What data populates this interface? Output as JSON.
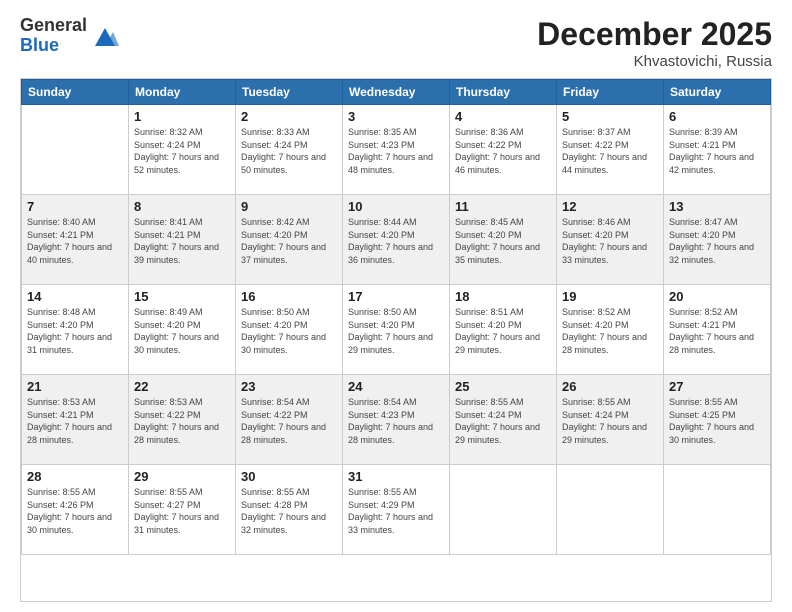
{
  "logo": {
    "general": "General",
    "blue": "Blue"
  },
  "header": {
    "month": "December 2025",
    "location": "Khvastovichi, Russia"
  },
  "weekdays": [
    "Sunday",
    "Monday",
    "Tuesday",
    "Wednesday",
    "Thursday",
    "Friday",
    "Saturday"
  ],
  "weeks": [
    [
      {
        "day": "",
        "sunrise": "",
        "sunset": "",
        "daylight": ""
      },
      {
        "day": "1",
        "sunrise": "Sunrise: 8:32 AM",
        "sunset": "Sunset: 4:24 PM",
        "daylight": "Daylight: 7 hours and 52 minutes."
      },
      {
        "day": "2",
        "sunrise": "Sunrise: 8:33 AM",
        "sunset": "Sunset: 4:24 PM",
        "daylight": "Daylight: 7 hours and 50 minutes."
      },
      {
        "day": "3",
        "sunrise": "Sunrise: 8:35 AM",
        "sunset": "Sunset: 4:23 PM",
        "daylight": "Daylight: 7 hours and 48 minutes."
      },
      {
        "day": "4",
        "sunrise": "Sunrise: 8:36 AM",
        "sunset": "Sunset: 4:22 PM",
        "daylight": "Daylight: 7 hours and 46 minutes."
      },
      {
        "day": "5",
        "sunrise": "Sunrise: 8:37 AM",
        "sunset": "Sunset: 4:22 PM",
        "daylight": "Daylight: 7 hours and 44 minutes."
      },
      {
        "day": "6",
        "sunrise": "Sunrise: 8:39 AM",
        "sunset": "Sunset: 4:21 PM",
        "daylight": "Daylight: 7 hours and 42 minutes."
      }
    ],
    [
      {
        "day": "7",
        "sunrise": "Sunrise: 8:40 AM",
        "sunset": "Sunset: 4:21 PM",
        "daylight": "Daylight: 7 hours and 40 minutes."
      },
      {
        "day": "8",
        "sunrise": "Sunrise: 8:41 AM",
        "sunset": "Sunset: 4:21 PM",
        "daylight": "Daylight: 7 hours and 39 minutes."
      },
      {
        "day": "9",
        "sunrise": "Sunrise: 8:42 AM",
        "sunset": "Sunset: 4:20 PM",
        "daylight": "Daylight: 7 hours and 37 minutes."
      },
      {
        "day": "10",
        "sunrise": "Sunrise: 8:44 AM",
        "sunset": "Sunset: 4:20 PM",
        "daylight": "Daylight: 7 hours and 36 minutes."
      },
      {
        "day": "11",
        "sunrise": "Sunrise: 8:45 AM",
        "sunset": "Sunset: 4:20 PM",
        "daylight": "Daylight: 7 hours and 35 minutes."
      },
      {
        "day": "12",
        "sunrise": "Sunrise: 8:46 AM",
        "sunset": "Sunset: 4:20 PM",
        "daylight": "Daylight: 7 hours and 33 minutes."
      },
      {
        "day": "13",
        "sunrise": "Sunrise: 8:47 AM",
        "sunset": "Sunset: 4:20 PM",
        "daylight": "Daylight: 7 hours and 32 minutes."
      }
    ],
    [
      {
        "day": "14",
        "sunrise": "Sunrise: 8:48 AM",
        "sunset": "Sunset: 4:20 PM",
        "daylight": "Daylight: 7 hours and 31 minutes."
      },
      {
        "day": "15",
        "sunrise": "Sunrise: 8:49 AM",
        "sunset": "Sunset: 4:20 PM",
        "daylight": "Daylight: 7 hours and 30 minutes."
      },
      {
        "day": "16",
        "sunrise": "Sunrise: 8:50 AM",
        "sunset": "Sunset: 4:20 PM",
        "daylight": "Daylight: 7 hours and 30 minutes."
      },
      {
        "day": "17",
        "sunrise": "Sunrise: 8:50 AM",
        "sunset": "Sunset: 4:20 PM",
        "daylight": "Daylight: 7 hours and 29 minutes."
      },
      {
        "day": "18",
        "sunrise": "Sunrise: 8:51 AM",
        "sunset": "Sunset: 4:20 PM",
        "daylight": "Daylight: 7 hours and 29 minutes."
      },
      {
        "day": "19",
        "sunrise": "Sunrise: 8:52 AM",
        "sunset": "Sunset: 4:20 PM",
        "daylight": "Daylight: 7 hours and 28 minutes."
      },
      {
        "day": "20",
        "sunrise": "Sunrise: 8:52 AM",
        "sunset": "Sunset: 4:21 PM",
        "daylight": "Daylight: 7 hours and 28 minutes."
      }
    ],
    [
      {
        "day": "21",
        "sunrise": "Sunrise: 8:53 AM",
        "sunset": "Sunset: 4:21 PM",
        "daylight": "Daylight: 7 hours and 28 minutes."
      },
      {
        "day": "22",
        "sunrise": "Sunrise: 8:53 AM",
        "sunset": "Sunset: 4:22 PM",
        "daylight": "Daylight: 7 hours and 28 minutes."
      },
      {
        "day": "23",
        "sunrise": "Sunrise: 8:54 AM",
        "sunset": "Sunset: 4:22 PM",
        "daylight": "Daylight: 7 hours and 28 minutes."
      },
      {
        "day": "24",
        "sunrise": "Sunrise: 8:54 AM",
        "sunset": "Sunset: 4:23 PM",
        "daylight": "Daylight: 7 hours and 28 minutes."
      },
      {
        "day": "25",
        "sunrise": "Sunrise: 8:55 AM",
        "sunset": "Sunset: 4:24 PM",
        "daylight": "Daylight: 7 hours and 29 minutes."
      },
      {
        "day": "26",
        "sunrise": "Sunrise: 8:55 AM",
        "sunset": "Sunset: 4:24 PM",
        "daylight": "Daylight: 7 hours and 29 minutes."
      },
      {
        "day": "27",
        "sunrise": "Sunrise: 8:55 AM",
        "sunset": "Sunset: 4:25 PM",
        "daylight": "Daylight: 7 hours and 30 minutes."
      }
    ],
    [
      {
        "day": "28",
        "sunrise": "Sunrise: 8:55 AM",
        "sunset": "Sunset: 4:26 PM",
        "daylight": "Daylight: 7 hours and 30 minutes."
      },
      {
        "day": "29",
        "sunrise": "Sunrise: 8:55 AM",
        "sunset": "Sunset: 4:27 PM",
        "daylight": "Daylight: 7 hours and 31 minutes."
      },
      {
        "day": "30",
        "sunrise": "Sunrise: 8:55 AM",
        "sunset": "Sunset: 4:28 PM",
        "daylight": "Daylight: 7 hours and 32 minutes."
      },
      {
        "day": "31",
        "sunrise": "Sunrise: 8:55 AM",
        "sunset": "Sunset: 4:29 PM",
        "daylight": "Daylight: 7 hours and 33 minutes."
      },
      {
        "day": "",
        "sunrise": "",
        "sunset": "",
        "daylight": ""
      },
      {
        "day": "",
        "sunrise": "",
        "sunset": "",
        "daylight": ""
      },
      {
        "day": "",
        "sunrise": "",
        "sunset": "",
        "daylight": ""
      }
    ]
  ]
}
